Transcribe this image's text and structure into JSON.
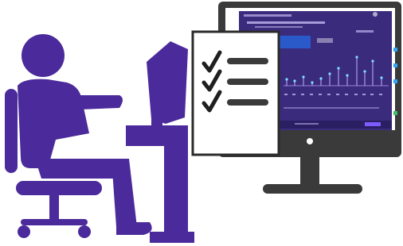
{
  "illustration": {
    "screen_header": {
      "app_name": "",
      "title": "",
      "subtitle": "",
      "button_label": ""
    },
    "checklist": {
      "checked_items": 3
    },
    "colors": {
      "person": "#4b2a9b",
      "monitor_body": "#3a3a3a",
      "monitor_screen_bg": "#ffffff",
      "screen_purple": "#3b2b7d",
      "screen_card_blue": "#2a59c9",
      "paper_border": "#2b2b2b",
      "checkmark": "#1f1f1f"
    }
  }
}
